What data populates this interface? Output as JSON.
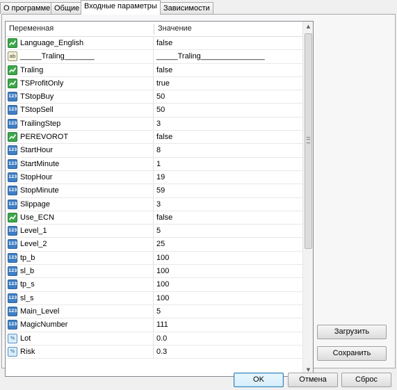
{
  "tabs": [
    {
      "label": "О программе",
      "active": false
    },
    {
      "label": "Общие",
      "active": false
    },
    {
      "label": "Входные параметры",
      "active": true
    },
    {
      "label": "Зависимости",
      "active": false
    }
  ],
  "grid": {
    "col_variable": "Переменная",
    "col_value": "Значение",
    "rows": [
      {
        "name": "Language_English",
        "value": "false",
        "type": "bool"
      },
      {
        "name": "_____Traling_______",
        "value": "_____Traling_______________",
        "type": "string"
      },
      {
        "name": "Traling",
        "value": "false",
        "type": "bool"
      },
      {
        "name": "TSProfitOnly",
        "value": "true",
        "type": "bool"
      },
      {
        "name": "TStopBuy",
        "value": "50",
        "type": "int"
      },
      {
        "name": "TStopSell",
        "value": "50",
        "type": "int"
      },
      {
        "name": "TrailingStep",
        "value": "3",
        "type": "int"
      },
      {
        "name": "PEREVOROT",
        "value": "false",
        "type": "bool"
      },
      {
        "name": "StartHour",
        "value": "8",
        "type": "int"
      },
      {
        "name": "StartMinute",
        "value": "1",
        "type": "int"
      },
      {
        "name": "StopHour",
        "value": "19",
        "type": "int"
      },
      {
        "name": "StopMinute",
        "value": "59",
        "type": "int"
      },
      {
        "name": "Slippage",
        "value": "3",
        "type": "int"
      },
      {
        "name": "Use_ECN",
        "value": "false",
        "type": "bool"
      },
      {
        "name": "Level_1",
        "value": "5",
        "type": "int"
      },
      {
        "name": "Level_2",
        "value": "25",
        "type": "int"
      },
      {
        "name": "tp_b",
        "value": "100",
        "type": "int"
      },
      {
        "name": "sl_b",
        "value": "100",
        "type": "int"
      },
      {
        "name": "tp_s",
        "value": "100",
        "type": "int"
      },
      {
        "name": "sl_s",
        "value": "100",
        "type": "int"
      },
      {
        "name": "Main_Level",
        "value": "5",
        "type": "int"
      },
      {
        "name": "MagicNumber",
        "value": "111",
        "type": "int"
      },
      {
        "name": "Lot",
        "value": "0.0",
        "type": "double"
      },
      {
        "name": "Risk",
        "value": "0.3",
        "type": "double"
      }
    ]
  },
  "type_icons": {
    "bool": {
      "glyph": "",
      "icon": "bool-type-icon"
    },
    "string": {
      "glyph": "ab",
      "icon": "string-type-icon"
    },
    "int": {
      "glyph": "123",
      "icon": "integer-type-icon"
    },
    "double": {
      "glyph": "½",
      "icon": "double-type-icon"
    }
  },
  "buttons": {
    "load": "Загрузить",
    "save": "Сохранить",
    "ok": "OK",
    "cancel": "Отмена",
    "reset": "Сброс"
  }
}
